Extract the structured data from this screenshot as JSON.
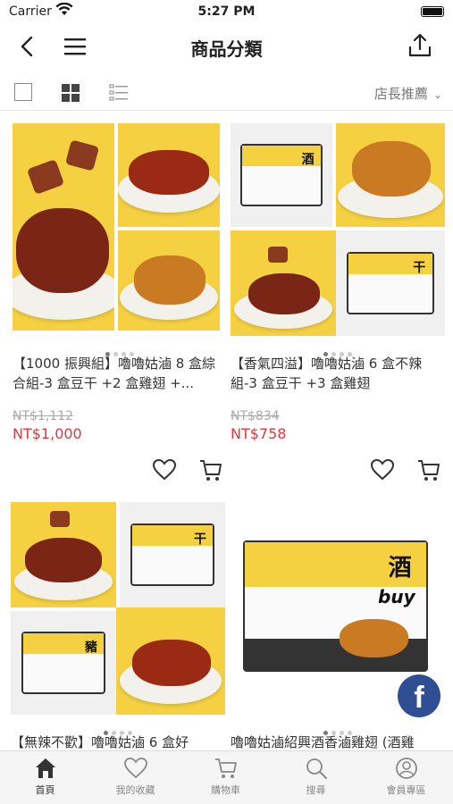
{
  "status_bar": {
    "carrier": "Carrier",
    "time": "5:27 PM"
  },
  "nav": {
    "title": "商品分類"
  },
  "toolbar": {
    "sort_label": "店長推薦"
  },
  "products": [
    {
      "name": "【1000 振興組】嚕嚕姑滷 8 盒綜合組-3 盒豆干 +2 盒雞翅 +...",
      "original_price": "NT$1,112",
      "price": "NT$1,000"
    },
    {
      "name": "【香氣四溢】嚕嚕姑滷 6 盒不辣組-3 盒豆干 +3 盒雞翅",
      "original_price": "NT$834",
      "price": "NT$758"
    },
    {
      "name": "【無辣不歡】嚕嚕姑滷 6 盒好",
      "original_price": "",
      "price": ""
    },
    {
      "name": "嚕嚕姑滷紹興酒香滷雞翅 (酒雞",
      "original_price": "",
      "price": ""
    }
  ],
  "box_texts": {
    "wine": "酒",
    "buy": "buy",
    "dry": "干",
    "pork": "豬"
  },
  "facebook": {
    "label": "f"
  },
  "tabbar": [
    {
      "label": "首頁",
      "active": true
    },
    {
      "label": "我的收藏",
      "active": false
    },
    {
      "label": "購物車",
      "active": false
    },
    {
      "label": "搜尋",
      "active": false
    },
    {
      "label": "會員專區",
      "active": false
    }
  ],
  "colors": {
    "price_red": "#e5383b",
    "facebook_blue": "#2f4e94",
    "brand_yellow": "#f5d142"
  }
}
